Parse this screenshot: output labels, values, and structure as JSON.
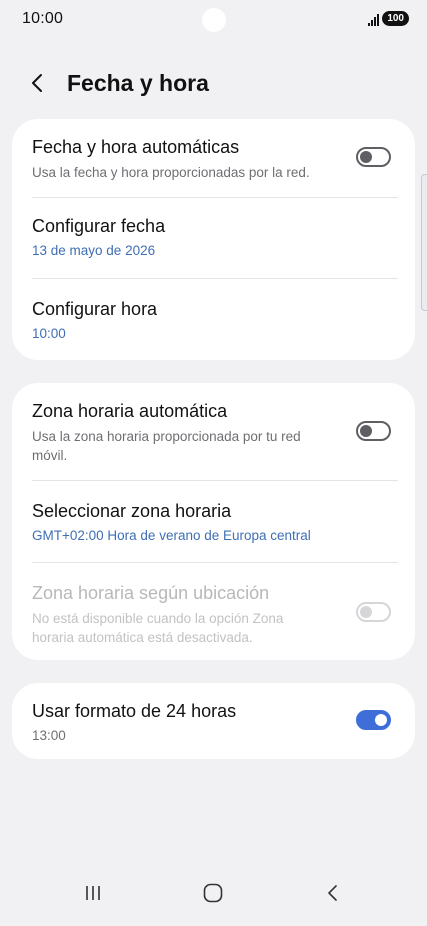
{
  "status_bar": {
    "time": "10:00",
    "battery": "100"
  },
  "header": {
    "title": "Fecha y hora"
  },
  "sections": {
    "auto_datetime": {
      "title": "Fecha y hora automáticas",
      "subtitle": "Usa la fecha y hora proporcionadas por la red.",
      "enabled": false
    },
    "set_date": {
      "title": "Configurar fecha",
      "value": "13 de mayo de 2026"
    },
    "set_time": {
      "title": "Configurar hora",
      "value": "10:00"
    },
    "auto_timezone": {
      "title": "Zona horaria automática",
      "subtitle_line1": "Usa la zona horaria proporcionada por tu red",
      "subtitle_line2": "móvil.",
      "enabled": false
    },
    "select_timezone": {
      "title": "Seleccionar zona horaria",
      "value": "GMT+02:00 Hora de verano de Europa central"
    },
    "location_timezone": {
      "title": "Zona horaria según ubicación",
      "subtitle_line1": "No está disponible cuando la opción Zona",
      "subtitle_line2": "horaria automática está desactivada.",
      "enabled": false,
      "disabled": true
    },
    "format_24h": {
      "title": "Usar formato de 24 horas",
      "value": "13:00",
      "enabled": true
    }
  },
  "colors": {
    "background": "#f1f1f4",
    "card": "#ffffff",
    "accent": "#3e6fd9",
    "link_text": "#3f6fb4"
  },
  "icons": {
    "back": "chevron-left-icon",
    "signal": "signal-icon",
    "nav_recents": "recents-icon",
    "nav_home": "home-icon",
    "nav_back": "nav-back-icon"
  }
}
